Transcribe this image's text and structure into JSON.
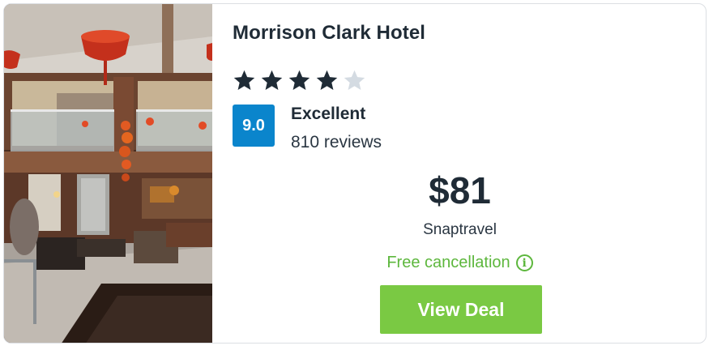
{
  "hotel": {
    "name": "Morrison Clark Hotel",
    "star_rating": 4,
    "star_max": 5,
    "photo_icon": "hotel-lobby-photo"
  },
  "rating": {
    "score": "9.0",
    "label": "Excellent",
    "reviews": "810 reviews"
  },
  "deal": {
    "price": "$81",
    "provider": "Snaptravel",
    "cancellation": "Free cancellation",
    "cancellation_info_icon": "info-icon",
    "button_label": "View Deal"
  },
  "colors": {
    "badge": "#0a85cc",
    "star_filled": "#1f2b36",
    "star_empty": "#d4dbe2",
    "cancellation_text": "#5db73d",
    "button": "#7ac943",
    "title_text": "#1f2b36"
  }
}
